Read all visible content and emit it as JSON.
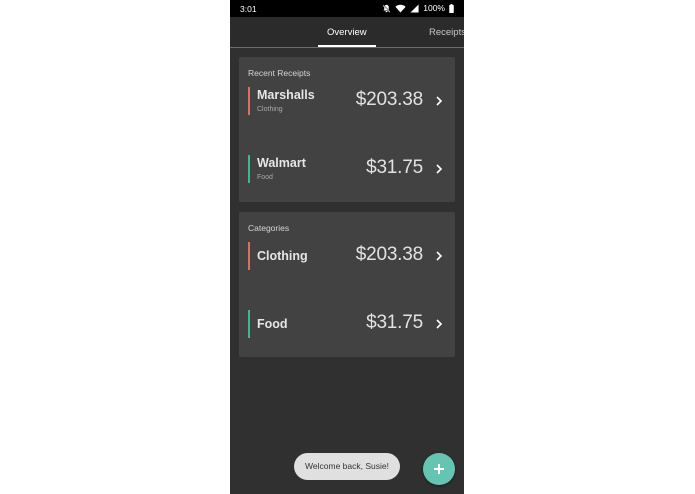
{
  "status_bar": {
    "time": "3:01",
    "battery": "100%",
    "icons": [
      "bell-off-icon",
      "wifi-icon",
      "signal-icon",
      "battery-icon"
    ]
  },
  "tabs": [
    {
      "label": "Overview",
      "selected": true
    },
    {
      "label": "Receipts",
      "selected": false
    }
  ],
  "recent": {
    "header": "Recent Receipts",
    "items": [
      {
        "name": "Marshalls",
        "category": "Clothing",
        "amount": "$203.38",
        "color": "#e06c62"
      },
      {
        "name": "Walmart",
        "category": "Food",
        "amount": "$31.75",
        "color": "#3cb98f"
      }
    ]
  },
  "categories": {
    "header": "Categories",
    "items": [
      {
        "name": "Clothing",
        "amount": "$203.38",
        "color": "#e06c62"
      },
      {
        "name": "Food",
        "amount": "$31.75",
        "color": "#3cb98f"
      }
    ]
  },
  "toast": {
    "message": "Welcome back, Susie!"
  },
  "fab": {
    "icon": "plus-icon",
    "color": "#66c5b2"
  },
  "colors": {
    "background": "#303030",
    "card": "#424242",
    "accent": "#66c5b2"
  }
}
